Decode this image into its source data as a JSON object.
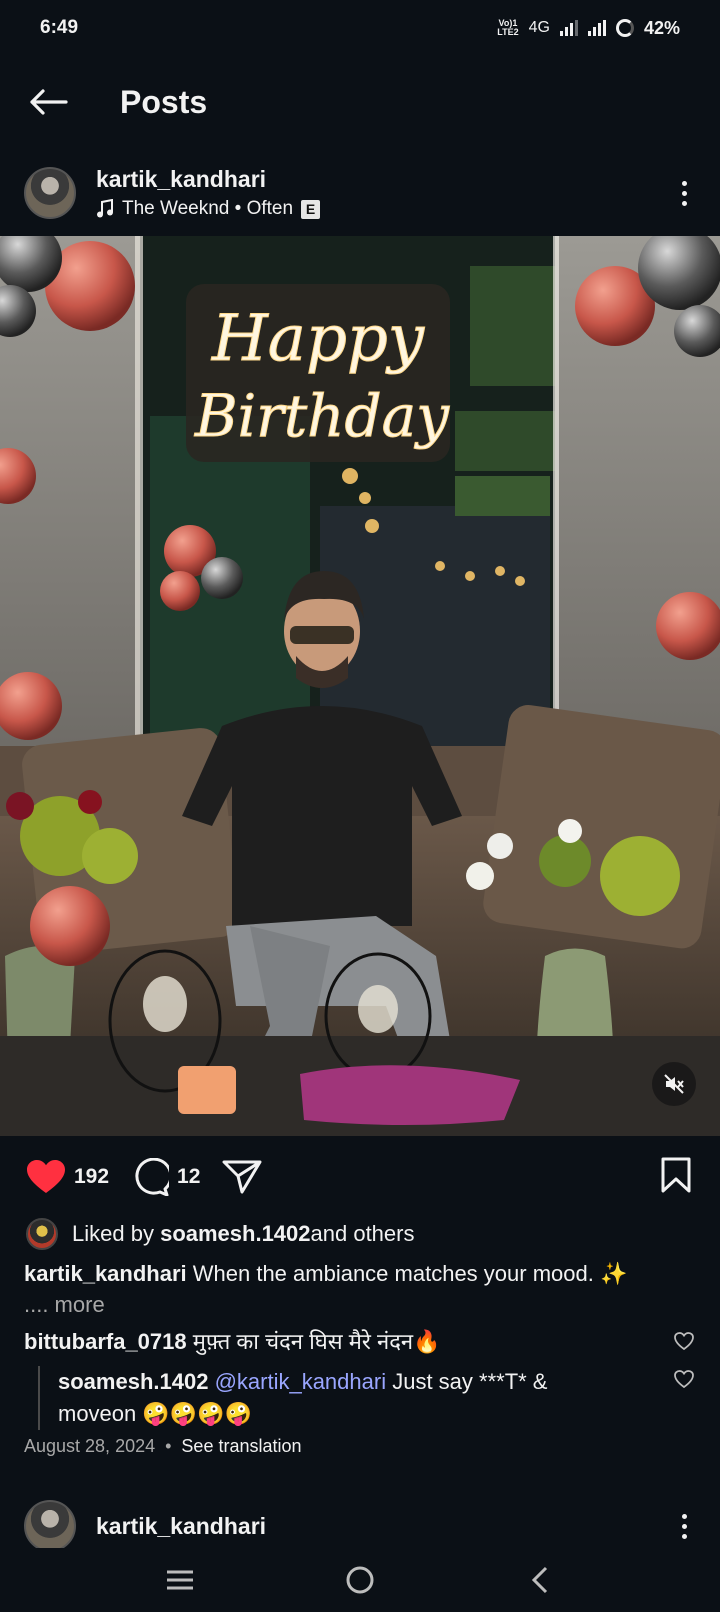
{
  "status_bar": {
    "time": "6:49",
    "volte": "Vo) 1\nLTE2",
    "network": "4G",
    "battery": "42%"
  },
  "header": {
    "title": "Posts",
    "back_icon": "arrow-left-icon"
  },
  "post": {
    "username": "kartik_kandhari",
    "music": "The Weeknd • Often",
    "explicit_badge": "E",
    "image_text": {
      "line1": "Happy",
      "line2": "Birthday"
    },
    "likes": "192",
    "comments_count": "12",
    "liked_by_prefix": "Liked by ",
    "liked_by_user": "soamesh.1402",
    "liked_by_suffix": " and others",
    "caption_user": "kartik_kandhari",
    "caption_text": " When the ambiance matches your mood. ✨",
    "more_label": ".... more",
    "comments": [
      {
        "user": "bittubarfa_0718",
        "text": " मुफ़्त का चंदन घिस मैरे नंदन🔥"
      }
    ],
    "reply": {
      "user": "soamesh.1402",
      "mention": "@kartik_kandhari",
      "text": " Just say ***T* & moveon 🤪🤪🤪🤪"
    },
    "date": "August 28, 2024",
    "separator": "•",
    "see_translation": "See translation"
  },
  "next_post": {
    "username": "kartik_kandhari"
  },
  "colors": {
    "background": "#0b1016",
    "like_red": "#ff3040",
    "mention_blue": "#9aa6ff"
  }
}
